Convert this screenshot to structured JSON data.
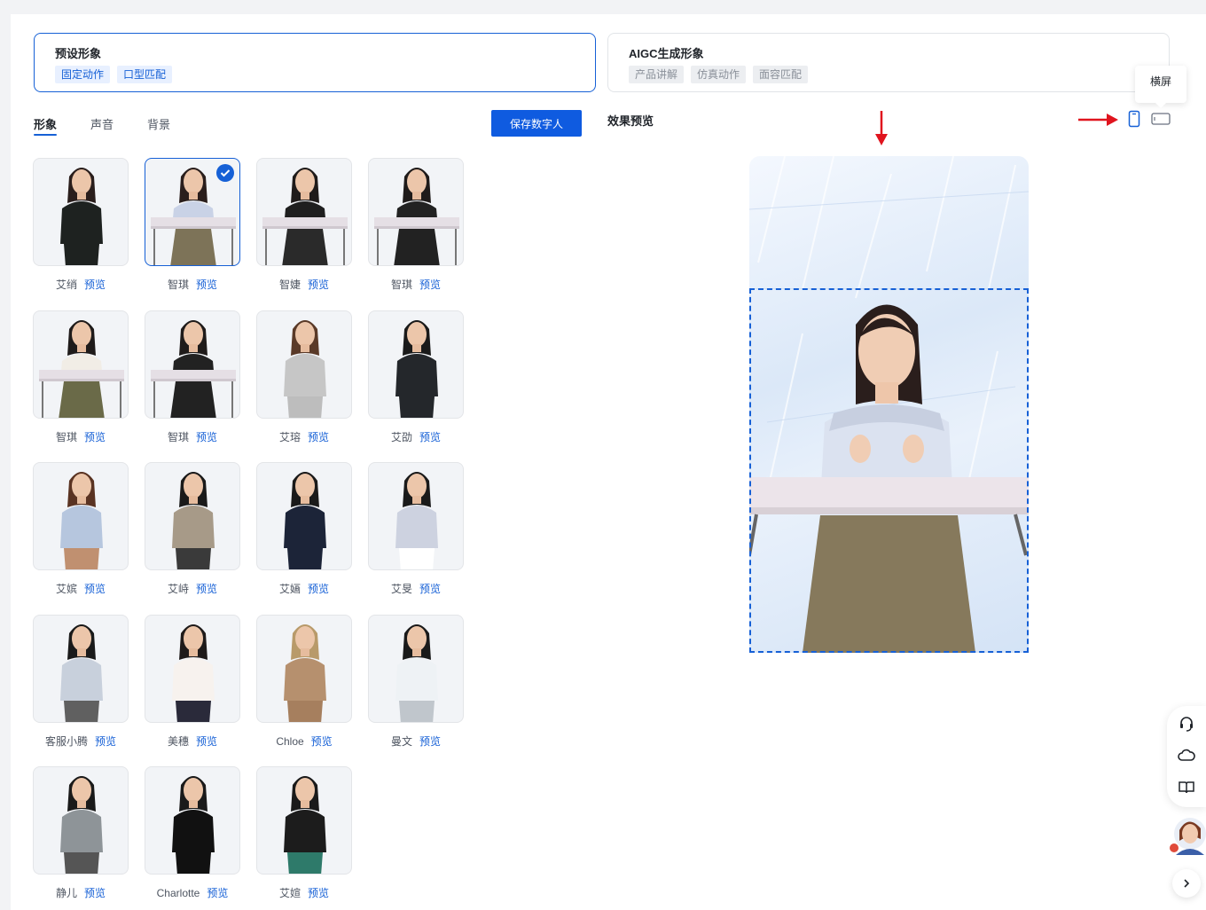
{
  "type_cards": {
    "preset": {
      "title": "预设形象",
      "tags": [
        "固定动作",
        "口型匹配"
      ]
    },
    "aigc": {
      "title": "AIGC生成形象",
      "tags": [
        "产品讲解",
        "仿真动作",
        "面容匹配"
      ]
    }
  },
  "tabs": [
    "形象",
    "声音",
    "背景"
  ],
  "save_button": "保存数字人",
  "preview": {
    "title": "效果预览",
    "tooltip": "横屏",
    "orientation_icons": [
      "portrait-icon",
      "landscape-icon"
    ]
  },
  "avatar_link_label": "预览",
  "avatars": [
    {
      "name": "艾绡",
      "selected": false
    },
    {
      "name": "智琪",
      "selected": true
    },
    {
      "name": "智婕",
      "selected": false
    },
    {
      "name": "智琪",
      "selected": false
    },
    {
      "name": "智琪",
      "selected": false
    },
    {
      "name": "智琪",
      "selected": false
    },
    {
      "name": "艾瑢",
      "selected": false
    },
    {
      "name": "艾劭",
      "selected": false
    },
    {
      "name": "艾嫔",
      "selected": false
    },
    {
      "name": "艾峙",
      "selected": false
    },
    {
      "name": "艾婳",
      "selected": false
    },
    {
      "name": "艾旻",
      "selected": false
    },
    {
      "name": "客服小腾",
      "selected": false
    },
    {
      "name": "美穗",
      "selected": false
    },
    {
      "name": "Chloe",
      "selected": false
    },
    {
      "name": "曼文",
      "selected": false
    },
    {
      "name": "静儿",
      "selected": false
    },
    {
      "name": "Charlotte",
      "selected": false
    },
    {
      "name": "艾媗",
      "selected": false
    }
  ],
  "float_bar_icons": [
    "headset-icon",
    "cloud-icon",
    "book-icon"
  ],
  "colors": {
    "accent": "#1660d6",
    "annotation_arrow": "#e0141e"
  }
}
